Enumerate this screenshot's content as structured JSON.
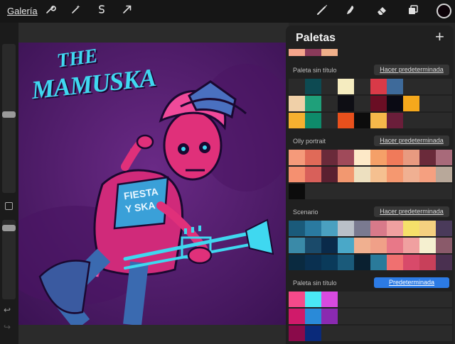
{
  "toolbar": {
    "gallery_label": "Galería",
    "left_icons": [
      "wrench-icon",
      "magic-wand-icon",
      "selection-s-icon",
      "arrow-transform-icon"
    ],
    "right_icons": [
      "brush-icon",
      "smudge-icon",
      "eraser-icon",
      "layers-icon"
    ],
    "current_color": "#0d0208"
  },
  "artwork": {
    "logo_line1": "THE",
    "logo_line2": "MAMUSKA",
    "shirt_line1": "FIESTA",
    "shirt_line2": "Y SKA",
    "accent_cyan": "#3fd8f0",
    "accent_pink": "#e0308a",
    "background": "#5a2277"
  },
  "palettes": {
    "title": "Paletas",
    "add_symbol": "+",
    "top_strip": [
      "#f5a58c",
      "#8a3a5a",
      "#f0b08a"
    ],
    "sections": [
      {
        "name": "Paleta sin título",
        "button": "Hacer predeterminada",
        "active": false,
        "rows": [
          [
            "#2a2a2a",
            "#0d4a52",
            "#2a2a2a",
            "#f5ecc0",
            "#2a2a2a",
            "#d93a48",
            "#3e6a9a",
            "#2a2a2a",
            "#2a2a2a",
            "#2a2a2a"
          ],
          [
            "#f0d0a8",
            "#1fa07a",
            "#2a2a2a",
            "#0e0e14",
            "#2a2a2a",
            "#6a0e24",
            "#0a0a14",
            "#f5a81c",
            "#2a2a2a",
            "#2a2a2a"
          ],
          [
            "#f5b030",
            "#0e8a6a",
            "#2a2a2a",
            "#e8501c",
            "#0c0c0c",
            "#f5b84a",
            "#6a1e3a",
            "#2a2a2a",
            "#2a2a2a",
            "#2a2a2a"
          ]
        ]
      },
      {
        "name": "Olly portrait",
        "button": "Hacer predeterminada",
        "active": false,
        "rows": [
          [
            "#f59a7a",
            "#e06a58",
            "#6a2a3a",
            "#a04a5a",
            "#fde9c8",
            "#f5a068",
            "#f07a5a",
            "#e89a80",
            "#6a2a3a",
            "#a86a7a"
          ],
          [
            "#f59070",
            "#d8605a",
            "#5a2030",
            "#f29870",
            "#ede0c0",
            "#f5c090",
            "#f59870",
            "#f0b092",
            "#f5a080",
            "#b8a89a"
          ],
          [
            "#0c0c0c",
            "#2a2a2a",
            "#2a2a2a",
            "#2a2a2a",
            "#2a2a2a",
            "#2a2a2a",
            "#2a2a2a",
            "#2a2a2a",
            "#2a2a2a",
            "#2a2a2a"
          ]
        ]
      },
      {
        "name": "Scenario",
        "button": "Hacer predeterminada",
        "active": false,
        "rows": [
          [
            "#1a5a7a",
            "#2a7aa0",
            "#4aa0c0",
            "#bac0c8",
            "#7a7a90",
            "#d87a8a",
            "#f0a0a0",
            "#f5e06a",
            "#f5d080",
            "#4a3a5a"
          ],
          [
            "#3a8aa8",
            "#1a4a6a",
            "#0a2a4a",
            "#4aa8c8",
            "#f0b090",
            "#f0a088",
            "#e87888",
            "#f0a0a0",
            "#f5f0d0",
            "#8a5a6a"
          ],
          [
            "#0a2a40",
            "#0a3050",
            "#0a3a5a",
            "#1a5a7a",
            "#0a2030",
            "#2a7a9a",
            "#f07070",
            "#d84a6a",
            "#c8405a",
            "#4a3050"
          ]
        ]
      },
      {
        "name": "Paleta sin título",
        "button": "Predeterminada",
        "active": true,
        "rows": [
          [
            "#f54a8a",
            "#4ae8f5",
            "#d84ae0",
            "#2a2a2a",
            "#2a2a2a",
            "#2a2a2a",
            "#2a2a2a",
            "#2a2a2a",
            "#2a2a2a",
            "#2a2a2a"
          ],
          [
            "#d01a6a",
            "#2a8ad8",
            "#8a2ab0",
            "#2a2a2a",
            "#2a2a2a",
            "#2a2a2a",
            "#2a2a2a",
            "#2a2a2a",
            "#2a2a2a",
            "#2a2a2a"
          ],
          [
            "#8a0a4a",
            "#0a2a7a",
            "#2a2a2a",
            "#2a2a2a",
            "#2a2a2a",
            "#2a2a2a",
            "#2a2a2a",
            "#2a2a2a",
            "#2a2a2a",
            "#2a2a2a"
          ]
        ]
      }
    ]
  },
  "sidebar": {
    "undo_symbol": "↩",
    "redo_symbol": "↪",
    "brush_size": 0.1,
    "opacity": 0.1
  }
}
